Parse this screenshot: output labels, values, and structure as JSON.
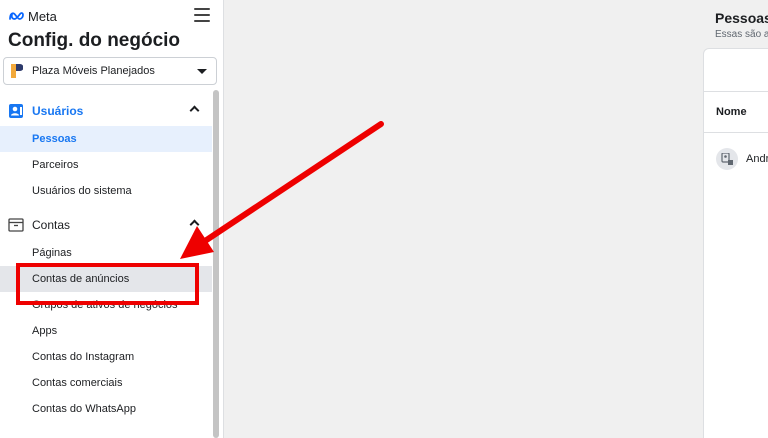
{
  "brand": {
    "logo_text": "Meta"
  },
  "header": {
    "title": "Config. do negócio"
  },
  "account_selector": {
    "value": "Plaza Móveis Planejados"
  },
  "sidebar": {
    "sections": [
      {
        "label": "Usuários",
        "icon": "users-icon",
        "active": true,
        "items": [
          {
            "label": "Pessoas",
            "selected": true
          },
          {
            "label": "Parceiros"
          },
          {
            "label": "Usuários do sistema"
          }
        ]
      },
      {
        "label": "Contas",
        "icon": "accounts-icon",
        "items": [
          {
            "label": "Páginas"
          },
          {
            "label": "Contas de anúncios",
            "hover": true
          },
          {
            "label": "Grupos de ativos de negócios"
          },
          {
            "label": "Apps"
          },
          {
            "label": "Contas do Instagram"
          },
          {
            "label": "Contas comerciais"
          },
          {
            "label": "Contas do WhatsApp"
          }
        ]
      }
    ]
  },
  "panel": {
    "title": "Pessoas",
    "subtitle": "Essas são a",
    "column_header": "Nome",
    "rows": [
      {
        "name": "Andr"
      }
    ]
  },
  "colors": {
    "accent": "#1877f2",
    "selected_bg": "#e7f0fd",
    "annotation": "#ee0000"
  }
}
